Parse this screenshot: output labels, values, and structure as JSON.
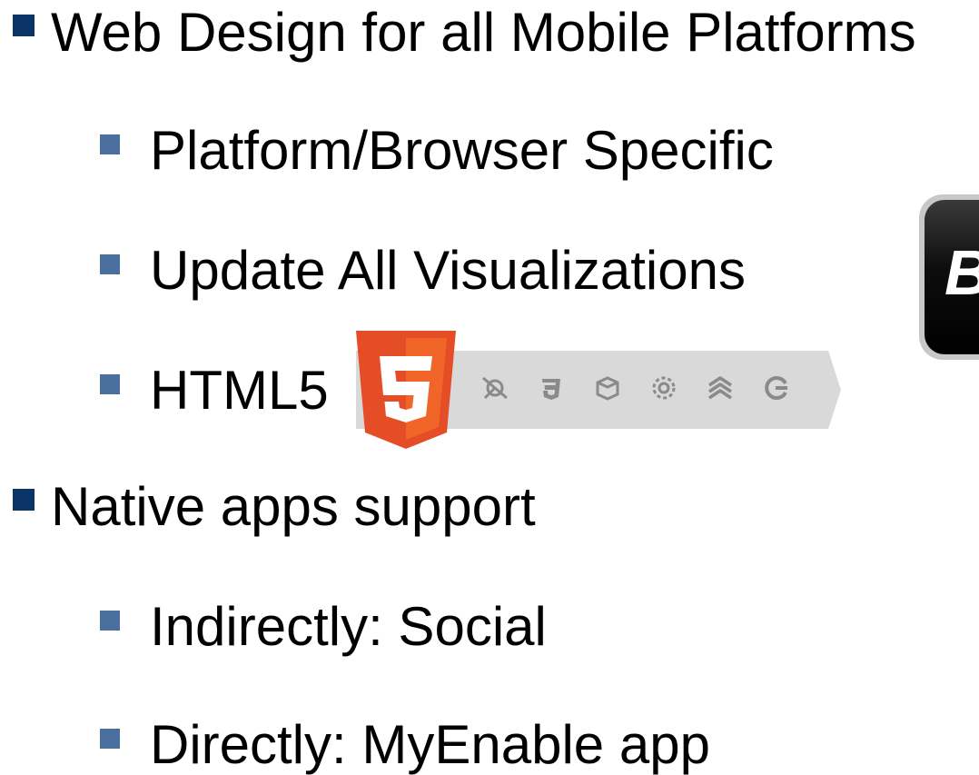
{
  "slide": {
    "bullets": [
      {
        "level": 1,
        "text": "Web Design for all Mobile Platforms"
      },
      {
        "level": 2,
        "text": "Platform/Browser Specific"
      },
      {
        "level": 2,
        "text": "Update All Visualizations"
      },
      {
        "level": 2,
        "text": "HTML5"
      },
      {
        "level": 1,
        "text": "Native apps support"
      },
      {
        "level": 2,
        "text": "Indirectly: Social"
      },
      {
        "level": 2,
        "text": "Directly:  MyEnable app"
      }
    ]
  },
  "html5_badge": {
    "shield_number": "5",
    "shield_color": "#e44d26",
    "strip_color": "#d9d9d9",
    "icons": [
      "connectivity-icon",
      "css3-icon",
      "offline-storage-icon",
      "device-access-icon",
      "performance-icon",
      "semantics-icon"
    ]
  },
  "app_icon": {
    "letter": "B"
  },
  "colors": {
    "level1_bullet": "#0b3466",
    "level2_bullet": "#4a6f9f",
    "text": "#000000"
  }
}
